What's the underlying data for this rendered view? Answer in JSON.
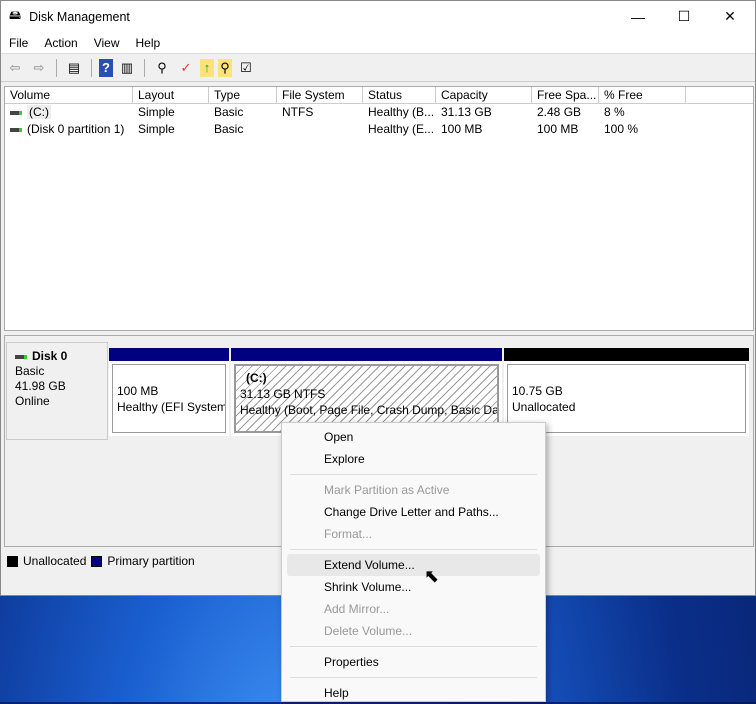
{
  "window": {
    "title": "Disk Management",
    "minimize": "—",
    "maximize": "☐",
    "close": "✕"
  },
  "menu": [
    "File",
    "Action",
    "View",
    "Help"
  ],
  "toolbar": [
    "back",
    "forward",
    "console-tree",
    "help",
    "action-pane",
    "connect",
    "check",
    "upload",
    "search",
    "properties"
  ],
  "table": {
    "columns": [
      "Volume",
      "Layout",
      "Type",
      "File System",
      "Status",
      "Capacity",
      "Free Spa...",
      "% Free"
    ],
    "rows": [
      [
        "(C:)",
        "Simple",
        "Basic",
        "NTFS",
        "Healthy (B...",
        "31.13 GB",
        "2.48 GB",
        "8 %"
      ],
      [
        "(Disk 0 partition 1)",
        "Simple",
        "Basic",
        "",
        "Healthy (E...",
        "100 MB",
        "100 MB",
        "100 %"
      ]
    ]
  },
  "disk": {
    "name": "Disk 0",
    "type": "Basic",
    "size": "41.98 GB",
    "status": "Online",
    "partitions": [
      {
        "line1": "100 MB",
        "line2": "Healthy (EFI System",
        "color": "#000080"
      },
      {
        "title": "(C:)",
        "line1": "31.13 GB NTFS",
        "line2": "Healthy (Boot, Page File, Crash Dump, Basic Data",
        "color": "#000080"
      },
      {
        "line1": "10.75 GB",
        "line2": "Unallocated",
        "color": "#000000"
      }
    ]
  },
  "legend": [
    {
      "label": "Unallocated",
      "color": "#000000"
    },
    {
      "label": "Primary partition",
      "color": "#000080"
    }
  ],
  "context_menu": {
    "items": [
      "Open",
      "Explore",
      "Mark Partition as Active",
      "Change Drive Letter and Paths...",
      "Format...",
      "Extend Volume...",
      "Shrink Volume...",
      "Add Mirror...",
      "Delete Volume...",
      "Properties",
      "Help"
    ]
  }
}
